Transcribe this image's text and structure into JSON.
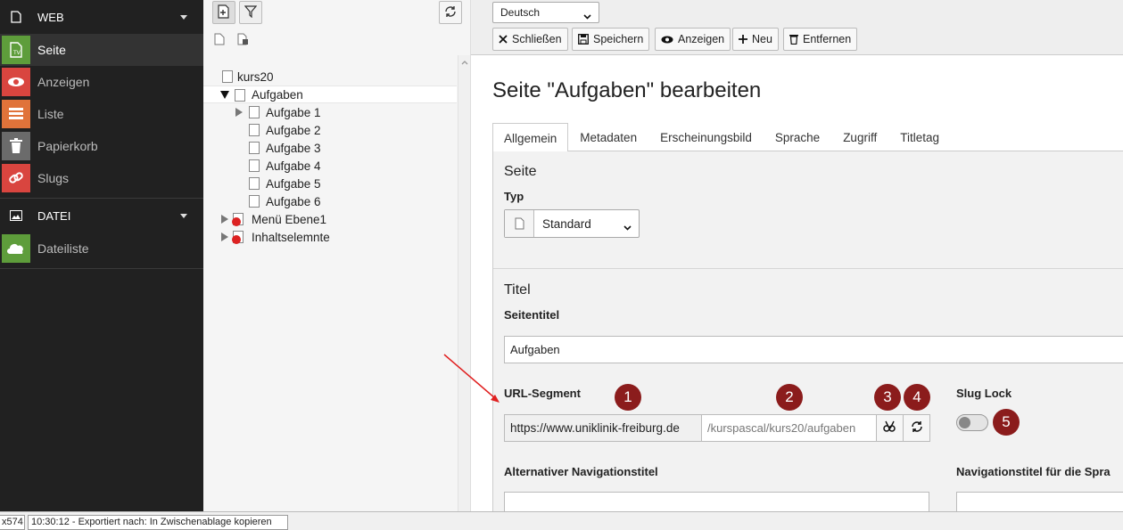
{
  "module_menu": {
    "groups": [
      {
        "label": "WEB",
        "icon": "document-icon",
        "items": [
          {
            "label": "Seite",
            "icon": "page-module-icon",
            "color": "#5e9d3b"
          },
          {
            "label": "Anzeigen",
            "icon": "eye-icon",
            "color": "#d9453f"
          },
          {
            "label": "Liste",
            "icon": "list-icon",
            "color": "#e0733a"
          },
          {
            "label": "Papierkorb",
            "icon": "trash-icon",
            "color": "#6b6b6b"
          },
          {
            "label": "Slugs",
            "icon": "link-icon",
            "color": "#d9453f"
          }
        ]
      },
      {
        "label": "DATEI",
        "icon": "image-icon",
        "items": [
          {
            "label": "Dateiliste",
            "icon": "filelist-icon",
            "color": "#5e9d3b"
          }
        ]
      }
    ]
  },
  "page_tree": {
    "root": "kurs20",
    "selected": "Aufgaben",
    "children": [
      "Aufgabe 1",
      "Aufgabe 2",
      "Aufgabe 3",
      "Aufgabe 4",
      "Aufgabe 5",
      "Aufgabe 6"
    ],
    "siblings": [
      "Menü Ebene1",
      "Inhaltselemnte"
    ]
  },
  "doc_header": {
    "language": "Deutsch",
    "buttons": {
      "close": "Schließen",
      "save": "Speichern",
      "view": "Anzeigen",
      "new": "Neu",
      "delete": "Entfernen"
    }
  },
  "editor": {
    "title": "Seite \"Aufgaben\" bearbeiten",
    "tabs": [
      "Allgemein",
      "Metadaten",
      "Erscheinungsbild",
      "Sprache",
      "Zugriff",
      "Titletag"
    ],
    "active_tab": "Allgemein",
    "section_page": {
      "heading": "Seite",
      "type_label": "Typ",
      "type_value": "Standard"
    },
    "section_title": {
      "heading": "Titel",
      "page_title_label": "Seitentitel",
      "page_title_value": "Aufgaben",
      "url_segment_label": "URL-Segment",
      "url_base": "https://www.uniklinik-freiburg.de",
      "url_path": "/kurspascal/kurs20/aufgaben",
      "slug_lock_label": "Slug Lock",
      "slug_lock_on": false,
      "alt_nav_title_label": "Alternativer Navigationstitel",
      "nav_title_lang_label": "Navigationstitel für die Spra"
    },
    "annotations": [
      "1",
      "2",
      "3",
      "4",
      "5"
    ],
    "annotation_color": "#8b1c1c"
  },
  "status_bar": {
    "left": "x574",
    "message": "10:30:12 - Exportiert nach: In Zwischenablage kopieren"
  }
}
